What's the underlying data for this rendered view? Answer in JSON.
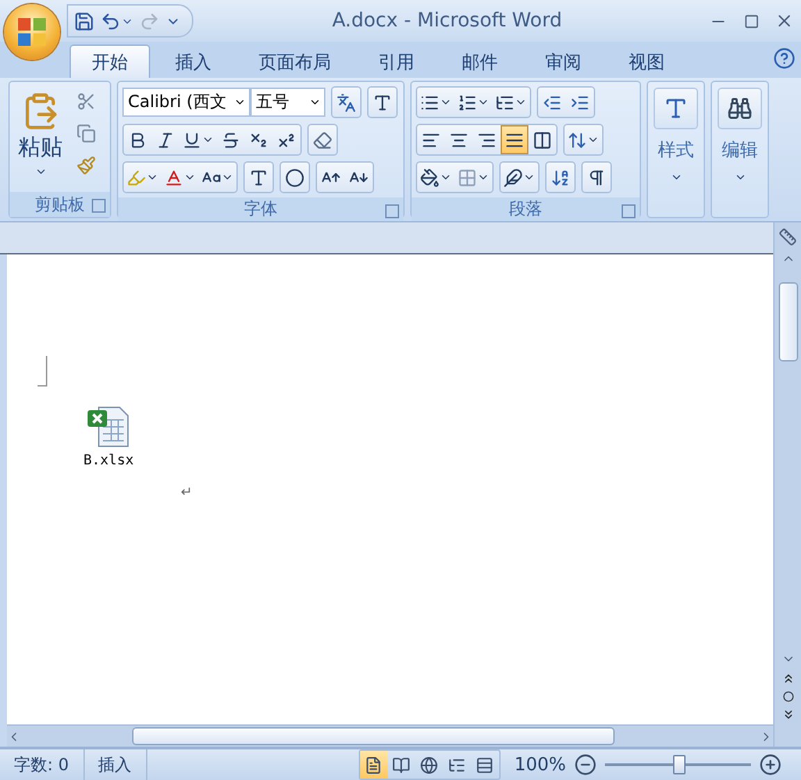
{
  "window": {
    "title": "A.docx - Microsoft Word"
  },
  "quick_access": [
    {
      "kind": "save",
      "disabled": false
    },
    {
      "kind": "undo",
      "disabled": false
    },
    {
      "kind": "redo",
      "disabled": true
    }
  ],
  "tabs": [
    {
      "label": "开始",
      "selected": true
    },
    {
      "label": "插入",
      "selected": false
    },
    {
      "label": "页面布局",
      "selected": false
    },
    {
      "label": "引用",
      "selected": false
    },
    {
      "label": "邮件",
      "selected": false
    },
    {
      "label": "审阅",
      "selected": false
    },
    {
      "label": "视图",
      "selected": false
    }
  ],
  "ribbon": {
    "clipboard": {
      "label": "剪贴板",
      "paste_label": "粘贴"
    },
    "font": {
      "label": "字体",
      "font_name": "Calibri (西文",
      "font_size": "五号"
    },
    "paragraph": {
      "label": "段落",
      "alignments": [
        {
          "kind": "left",
          "selected": false
        },
        {
          "kind": "center",
          "selected": false
        },
        {
          "kind": "right",
          "selected": false
        },
        {
          "kind": "justify",
          "selected": true
        },
        {
          "kind": "distributed",
          "selected": false
        }
      ]
    },
    "styles": {
      "label": "样式"
    },
    "editing": {
      "label": "编辑"
    }
  },
  "document": {
    "embedded_file": {
      "name": "B.xlsx"
    },
    "paragraph_mark": "↵"
  },
  "status_bar": {
    "items": [
      "字数: 0",
      "插入"
    ],
    "views": [
      {
        "kind": "print",
        "selected": true
      },
      {
        "kind": "reading",
        "selected": false
      },
      {
        "kind": "web",
        "selected": false
      },
      {
        "kind": "outline",
        "selected": false
      },
      {
        "kind": "draft",
        "selected": false
      }
    ],
    "zoom": {
      "reading": "100%",
      "level": 0.5
    }
  }
}
